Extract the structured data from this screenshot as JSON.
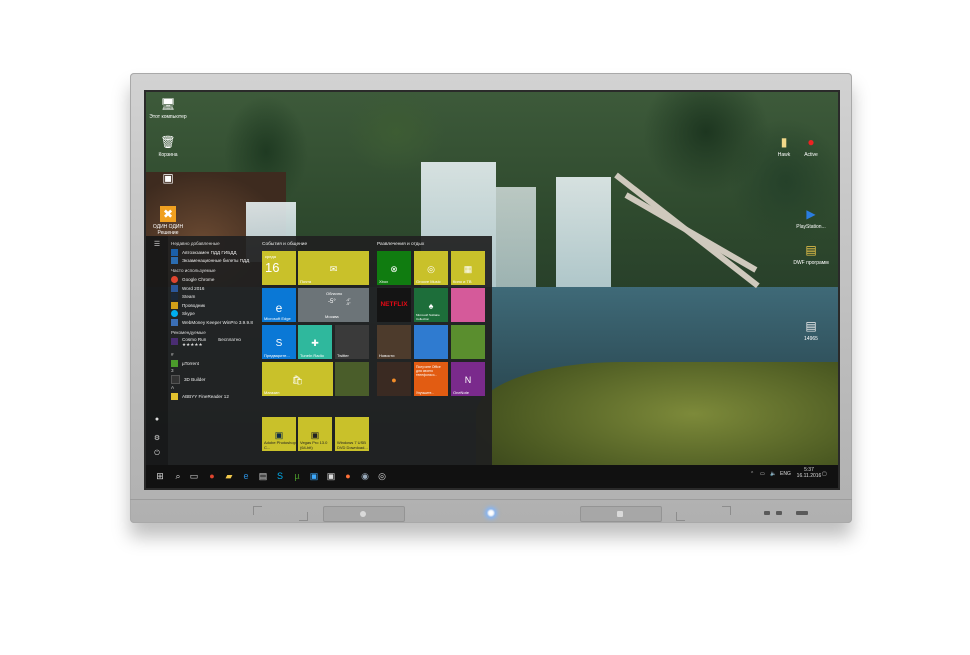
{
  "desktop": {
    "icons_left": [
      {
        "label": "Этот компьютер",
        "glyph": "🖥"
      },
      {
        "label": "Корзина",
        "glyph": "🗑"
      },
      {
        "label": "",
        "glyph": "▣"
      },
      {
        "label": "ОДИН ОДИН Решение",
        "glyph": "✖"
      }
    ],
    "icons_right": [
      {
        "label": "Hawk",
        "glyph": "▮"
      },
      {
        "label": "Active",
        "glyph": "●"
      },
      {
        "label": "PlayStation...",
        "glyph": "▶"
      },
      {
        "label": "DWF программ",
        "glyph": "▤"
      },
      {
        "label": "14965",
        "glyph": "▤"
      }
    ]
  },
  "start_menu": {
    "recent_header": "Недавно добавленные",
    "recent": [
      {
        "label": "Автоэкзамен ПДД ГИБДД",
        "color": "#1b5fa8"
      },
      {
        "label": "Экзаменационные билеты ПДД",
        "color": "#2b6cb0"
      }
    ],
    "frequent_header": "Часто используемые",
    "frequent": [
      {
        "label": "Google Chrome",
        "color": "#e0452f"
      },
      {
        "label": "Word 2016",
        "color": "#2b579a"
      },
      {
        "label": "Steam",
        "color": "#1b2838"
      },
      {
        "label": "Проводник",
        "color": "#d4a017"
      },
      {
        "label": "Skype",
        "color": "#00aff0"
      },
      {
        "label": "WebMoney Keeper WinPro 3.9.9.8",
        "color": "#3b6fb6"
      }
    ],
    "recommended_header": "Рекомендуемые",
    "recommended": [
      {
        "label": "Cosmo Run",
        "rating": "★★★★★",
        "extra": "Бесплатно",
        "color": "#4a2d73"
      }
    ],
    "letter_m": "#",
    "app_utorrent": {
      "label": "µTorrent",
      "color": "#4b9b2b"
    },
    "letter_3": "3",
    "app_3dbuilder": {
      "label": "3D Builder",
      "color": "#333333"
    },
    "letter_a": "A",
    "app_abbyy": {
      "label": "ABBYY FineReader 12",
      "color": "#e2c12e"
    },
    "groups": {
      "left": "События и общение",
      "right": "Развлечения и отдых"
    },
    "tiles": {
      "calendar_day": "среда",
      "calendar_date": "16",
      "mail": "Почта",
      "weather_cond": "Облачно",
      "weather_temp": "-5°",
      "weather_range": "-4°\n-5°",
      "weather_city": "Москва",
      "edge": "Microsoft Edge",
      "skype": "Предварите...",
      "tunein": "TuneIn Radio",
      "twitter": "Twitter",
      "store": "Магазин",
      "xbox": "Xbox",
      "groove": "Groove Music",
      "movies": "Кино и ТВ",
      "netflix": "NETFLIX",
      "solitaire": "Microsoft Solitaire Collection",
      "news": "Новости",
      "getoffice": "Получите Office для своего телефона и...",
      "getoffice_link": "Улучшите...",
      "onenote": "OneNote",
      "minecraft": "",
      "photoshop": "Adobe Photoshop C...",
      "vegas": "Vegas Pro 13.0 (64-bit)",
      "windvd": "Windows 7 USB DVD Download..."
    }
  },
  "taskbar": {
    "lang": "ENG",
    "time": "5:37",
    "date": "16.11.2016"
  },
  "colors": {
    "tile_lime": "#c9c12a",
    "tile_blue": "#0a78d6",
    "tile_teal": "#2fb89d",
    "tile_green": "#107c10",
    "tile_orange": "#e25c12",
    "tile_purple": "#7a2a8c",
    "tile_dark": "#2b2b2b"
  }
}
